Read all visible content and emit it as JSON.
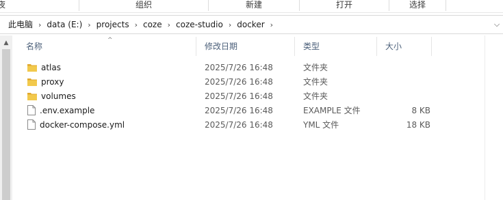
{
  "ribbon": {
    "groups": [
      "夜",
      "组织",
      "新建",
      "打开",
      "选择"
    ]
  },
  "address": {
    "crumbs": [
      "此电脑",
      "data (E:)",
      "projects",
      "coze",
      "coze-studio",
      "docker"
    ],
    "chevron": "›",
    "dropdown": "⌵"
  },
  "columns": {
    "name": "名称",
    "date": "修改日期",
    "type": "类型",
    "size": "大小"
  },
  "files": [
    {
      "name": "atlas",
      "date": "2025/7/26 16:48",
      "type": "文件夹",
      "size": "",
      "icon": "folder-icon"
    },
    {
      "name": "proxy",
      "date": "2025/7/26 16:48",
      "type": "文件夹",
      "size": "",
      "icon": "folder-icon"
    },
    {
      "name": "volumes",
      "date": "2025/7/26 16:48",
      "type": "文件夹",
      "size": "",
      "icon": "folder-icon"
    },
    {
      "name": ".env.example",
      "date": "2025/7/26 16:48",
      "type": "EXAMPLE 文件",
      "size": "8 KB",
      "icon": "file-icon"
    },
    {
      "name": "docker-compose.yml",
      "date": "2025/7/26 16:48",
      "type": "YML 文件",
      "size": "18 KB",
      "icon": "file-icon"
    }
  ],
  "colors": {
    "folder": "#f2c94c",
    "folder_dark": "#e0a82e",
    "header_text": "#4c607a"
  }
}
